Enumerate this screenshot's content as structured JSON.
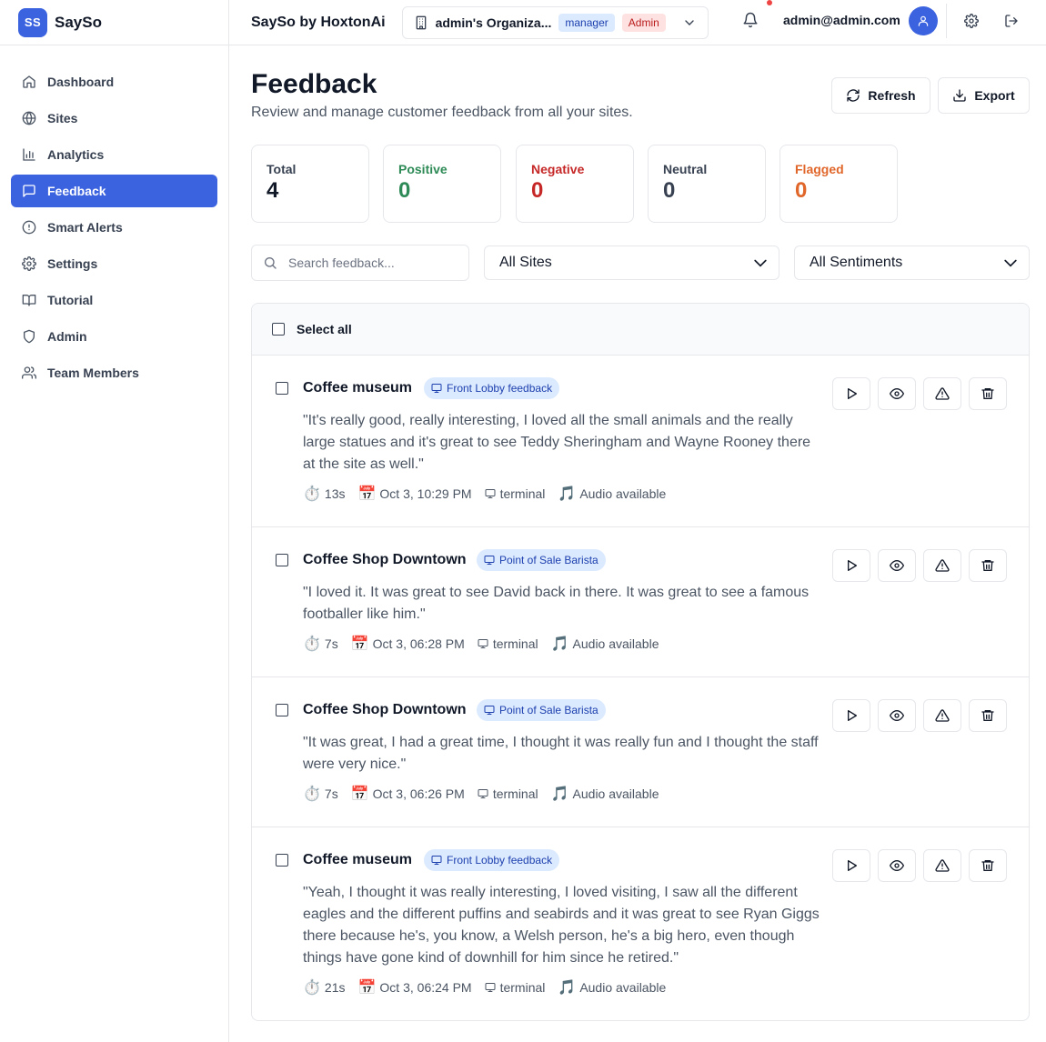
{
  "brand": {
    "logo": "SS",
    "name": "SaySo"
  },
  "sidebar": {
    "items": [
      {
        "label": "Dashboard",
        "icon": "home-icon",
        "active": false
      },
      {
        "label": "Sites",
        "icon": "globe-icon",
        "active": false
      },
      {
        "label": "Analytics",
        "icon": "bar-chart-icon",
        "active": false
      },
      {
        "label": "Feedback",
        "icon": "message-square-icon",
        "active": true
      },
      {
        "label": "Smart Alerts",
        "icon": "alert-circle-icon",
        "active": false
      },
      {
        "label": "Settings",
        "icon": "gear-icon",
        "active": false
      },
      {
        "label": "Tutorial",
        "icon": "book-icon",
        "active": false
      },
      {
        "label": "Admin",
        "icon": "shield-icon",
        "active": false
      },
      {
        "label": "Team Members",
        "icon": "users-icon",
        "active": false
      }
    ]
  },
  "header": {
    "title": "SaySo by HoxtonAi",
    "org_name": "admin's Organiza...",
    "role_tag": "manager",
    "admin_tag": "Admin",
    "user_email": "admin@admin.com"
  },
  "page": {
    "title": "Feedback",
    "subtitle": "Review and manage customer feedback from all your sites.",
    "refresh_label": "Refresh",
    "export_label": "Export"
  },
  "stats": [
    {
      "label": "Total",
      "value": "4",
      "color": "#111827",
      "label_color": "#374151"
    },
    {
      "label": "Positive",
      "value": "0",
      "color": "#2e8b57",
      "label_color": "#2e8b57"
    },
    {
      "label": "Negative",
      "value": "0",
      "color": "#c62828",
      "label_color": "#c62828"
    },
    {
      "label": "Neutral",
      "value": "0",
      "color": "#374151",
      "label_color": "#374151"
    },
    {
      "label": "Flagged",
      "value": "0",
      "color": "#e0662a",
      "label_color": "#e0662a"
    }
  ],
  "filters": {
    "search_placeholder": "Search feedback...",
    "sites_selected": "All Sites",
    "sentiments_selected": "All Sentiments"
  },
  "list": {
    "select_all_label": "Select all",
    "items": [
      {
        "site": "Coffee museum",
        "device_badge": "Front Lobby feedback",
        "text": "\"It's really good, really interesting, I loved all the small animals and the really large statues and it's great to see Teddy Sheringham and Wayne Rooney there at the site as well.\"",
        "duration": "13s",
        "date": "Oct 3, 10:29 PM",
        "source": "terminal",
        "audio": "Audio available"
      },
      {
        "site": "Coffee Shop Downtown",
        "device_badge": "Point of Sale Barista",
        "text": "\"I loved it. It was great to see David back in there. It was great to see a famous footballer like him.\"",
        "duration": "7s",
        "date": "Oct 3, 06:28 PM",
        "source": "terminal",
        "audio": "Audio available"
      },
      {
        "site": "Coffee Shop Downtown",
        "device_badge": "Point of Sale Barista",
        "text": "\"It was great, I had a great time, I thought it was really fun and I thought the staff were very nice.\"",
        "duration": "7s",
        "date": "Oct 3, 06:26 PM",
        "source": "terminal",
        "audio": "Audio available"
      },
      {
        "site": "Coffee museum",
        "device_badge": "Front Lobby feedback",
        "text": "\"Yeah, I thought it was really interesting, I loved visiting, I saw all the different eagles and the different puffins and seabirds and it was great to see Ryan Giggs there because he's, you know, a Welsh person, he's a big hero, even though things have gone kind of downhill for him since he retired.\"",
        "duration": "21s",
        "date": "Oct 3, 06:24 PM",
        "source": "terminal",
        "audio": "Audio available"
      }
    ]
  },
  "colors": {
    "accent": "#3b63e0",
    "badge_bg": "#dbeafe",
    "badge_text": "#1e40af"
  }
}
